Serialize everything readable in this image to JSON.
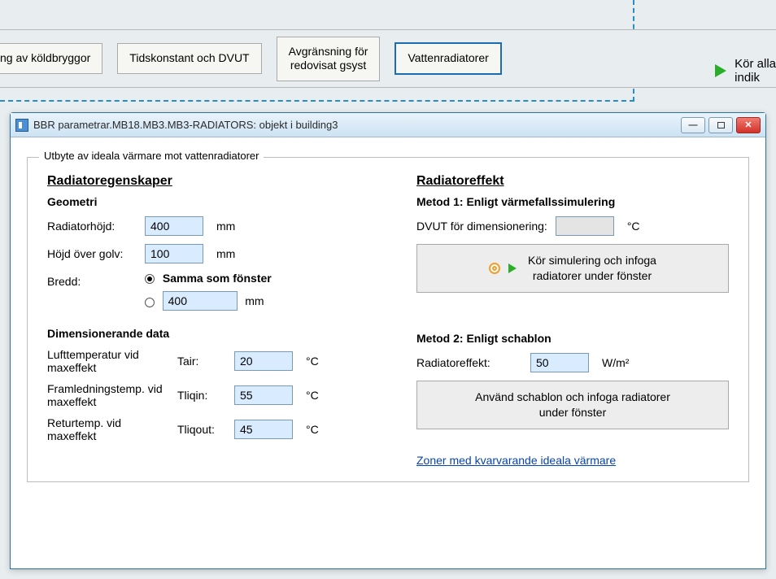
{
  "bg_tabs": {
    "partial_cold_bridges": "ng av köldbryggor",
    "time_const": "Tidskonstant och DVUT",
    "avg": "Avgränsning för\nredovisat gsyst",
    "water_rad": "Vattenradiatorer"
  },
  "run_panel": {
    "label": "Kör alla\nindik"
  },
  "dialog": {
    "title": "BBR parametrar.MB18.MB3.MB3-RADIATORS: objekt i building3",
    "group_legend": "Utbyte av ideala värmare mot vattenradiatorer",
    "left": {
      "heading": "Radiatoregenskaper",
      "geom_title": "Geometri",
      "height_label": "Radiatorhöjd:",
      "height_value": "400",
      "height_unit": "mm",
      "above_floor_label": "Höjd över golv:",
      "above_floor_value": "100",
      "above_floor_unit": "mm",
      "width_label": "Bredd:",
      "width_opt_same": "Samma som fönster",
      "width_value": "400",
      "width_unit": "mm",
      "dim_title": "Dimensionerande data",
      "tair_label": "Lufttemperatur vid maxeffekt",
      "tair_sym": "Tair:",
      "tair_value": "20",
      "tair_unit": "°C",
      "tliqin_label": "Framledningstemp. vid maxeffekt",
      "tliqin_sym": "Tliqin:",
      "tliqin_value": "55",
      "tliqin_unit": "°C",
      "tliqout_label": "Returtemp. vid maxeffekt",
      "tliqout_sym": "Tliqout:",
      "tliqout_value": "45",
      "tliqout_unit": "°C"
    },
    "right": {
      "heading": "Radiatoreffekt",
      "method1_title": "Metod 1: Enligt värmefallssimulering",
      "dvut_label": "DVUT för dimensionering:",
      "dvut_unit": "°C",
      "run_sim_btn": "Kör simulering och infoga\nradiatorer under fönster",
      "method2_title": "Metod 2: Enligt schablon",
      "rad_eff_label": "Radiatoreffekt:",
      "rad_eff_value": "50",
      "rad_eff_unit": "W/m²",
      "schablon_btn": "Använd schablon och infoga radiatorer\nunder fönster",
      "zones_link": "Zoner med kvarvarande ideala värmare"
    }
  }
}
